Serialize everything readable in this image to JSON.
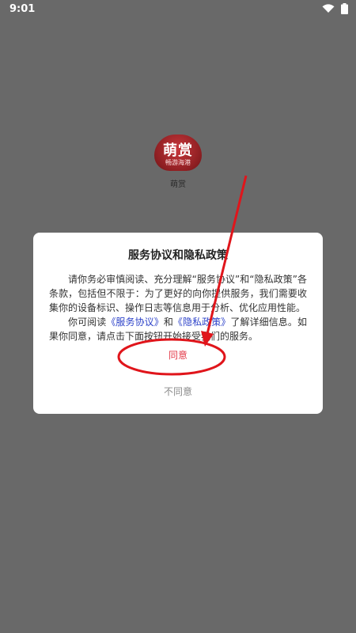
{
  "status_bar": {
    "time": "9:01",
    "icons": [
      "wifi-icon",
      "battery-icon"
    ]
  },
  "app": {
    "logo_text": "萌赏",
    "logo_subtext": "畅游海港",
    "name": "萌赏"
  },
  "dialog": {
    "title": "服务协议和隐私政策",
    "paragraph1": "请你务必审慎阅读、充分理解“服务协议”和“隐私政策”各条款，包括但不限于：为了更好的向你提供服务，我们需要收集你的设备标识、操作日志等信息用于分析、优化应用性能。",
    "p2_before": "你可阅读",
    "service_link": "《服务协议》",
    "p2_mid": "和",
    "privacy_link": "《隐私政策》",
    "p2_after": "了解详细信息。如果你同意，请点击下面按钮开始接受我们的服务。",
    "agree_label": "同意",
    "decline_label": "不同意"
  },
  "colors": {
    "overlay": "#696969",
    "agree": "#e33b4a",
    "link": "#2e43c9",
    "annotation": "#e0151b"
  }
}
